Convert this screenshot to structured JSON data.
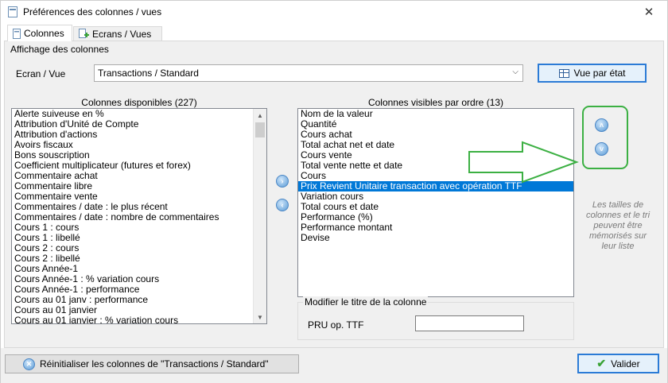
{
  "window": {
    "title": "Préférences des colonnes / vues",
    "close_glyph": "✕"
  },
  "tabs": [
    {
      "label": "Colonnes",
      "icon": "page-icon"
    },
    {
      "label": "Ecrans / Vues",
      "icon": "page-add-icon"
    }
  ],
  "section": {
    "title": "Affichage des colonnes"
  },
  "ecran": {
    "label": "Ecran / Vue",
    "value": "Transactions / Standard",
    "vue_button": "Vue par état"
  },
  "available": {
    "header": "Colonnes disponibles (227)",
    "items": [
      "Alerte suiveuse en %",
      "Attribution d'Unité de Compte",
      "Attribution d'actions",
      "Avoirs fiscaux",
      "Bons souscription",
      "Coefficient multiplicateur (futures et forex)",
      "Commentaire achat",
      "Commentaire libre",
      "Commentaire vente",
      "Commentaires / date : le plus récent",
      "Commentaires / date : nombre de commentaires",
      "Cours 1 : cours",
      "Cours 1 : libellé",
      "Cours 2 : cours",
      "Cours 2 : libellé",
      "Cours Année-1",
      "Cours Année-1 : % variation cours",
      "Cours Année-1 : performance",
      "Cours au 01 janv : performance",
      "Cours au 01 janvier",
      "Cours au 01 janvier : % variation cours"
    ]
  },
  "visible": {
    "header": "Colonnes visibles par ordre (13)",
    "items": [
      "Nom de la valeur",
      "Quantité",
      "Cours achat",
      "Total achat net et date",
      "Cours vente",
      "Total vente nette et date",
      "Cours",
      "Prix Revient Unitaire transaction avec opération TTF",
      "Variation cours",
      "Total cours et date",
      "Performance (%)",
      "Performance montant",
      "Devise"
    ],
    "selected_index": 7
  },
  "side_note": "Les tailles de colonnes et le tri peuvent être mémorisés sur leur liste",
  "rename": {
    "legend": "Modifier le titre de la colonne",
    "label": "PRU op. TTF",
    "value": ""
  },
  "footer": {
    "reset_label": "Réinitialiser les colonnes de \"Transactions / Standard\"",
    "valider_label": "Valider"
  },
  "colors": {
    "accent": "#2b7bd6",
    "selection": "#0078d7",
    "annotation": "#3cb043"
  }
}
